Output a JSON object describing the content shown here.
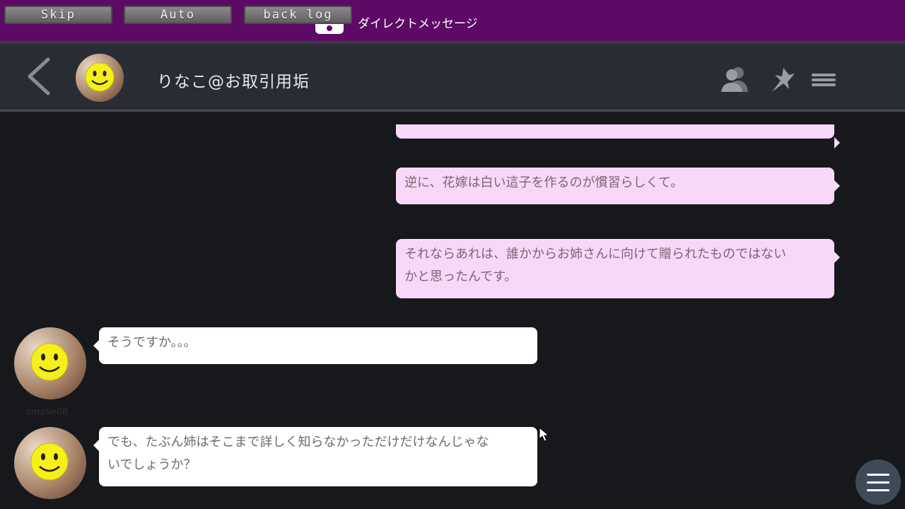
{
  "vn_controls": {
    "skip_label": "Skip",
    "auto_label": "Auto",
    "backlog_label": "back log"
  },
  "topbar": {
    "title": "ダイレクトメッセージ",
    "bg_color": "#5c0a66"
  },
  "header": {
    "contact_name": "りなこ@お取引用垢",
    "back_icon": "chevron-left-icon",
    "icons": [
      "profile-icon",
      "pin-icon",
      "menu-icon"
    ]
  },
  "messages": [
    {
      "side": "sent",
      "text": ""
    },
    {
      "side": "sent",
      "text": "逆に、花嫁は白い這子を作るのが慣習らしくて。"
    },
    {
      "side": "sent",
      "lines": [
        "それならあれは、誰かからお姉さんに向けて贈られたものではない",
        "かと思ったんです。"
      ]
    },
    {
      "side": "received",
      "username": "smalle08",
      "text": "そうですか。。。"
    },
    {
      "side": "received",
      "lines": [
        "でも、たぶん姉はそこまで詳しく知らなかっただけだけなんじゃな",
        "いでしょうか？"
      ]
    }
  ],
  "colors": {
    "sent_bubble": "#f8d8f8",
    "received_bubble": "#ffffff",
    "background": "#17181c"
  }
}
